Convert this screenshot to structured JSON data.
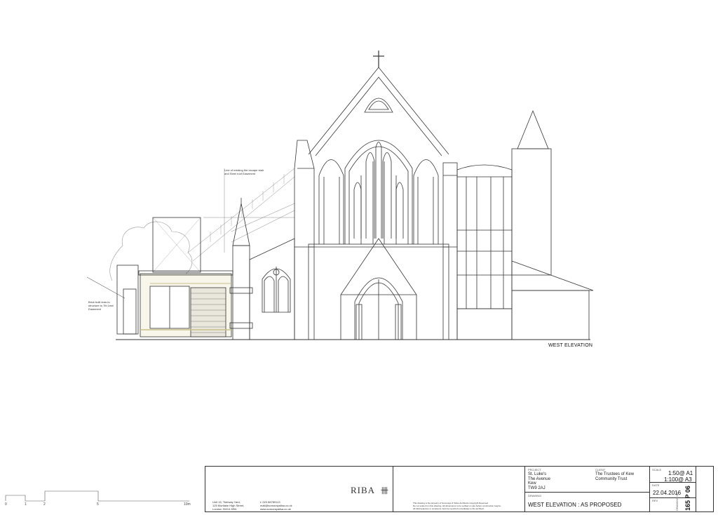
{
  "annotations": {
    "sightline_note": "Line of existing fire escape stair and Steel roof Easement",
    "left_note": "Brick built lean-to structure to 7th Leaf Easement",
    "elevation_title": "WEST ELEVATION"
  },
  "scale_bar": {
    "ticks": [
      "0",
      "1",
      "2",
      "5",
      "10m"
    ]
  },
  "title_block": {
    "office_address": [
      "Unit 15, Tideway Yard,",
      "125 Mortlake High Street,",
      "London SW14 8SN"
    ],
    "office_contact": [
      "t: 020 88789113",
      "mail@somorayallsa.co.uk",
      "www.somorayallsa.co.uk"
    ],
    "riba": "RIBA",
    "riba_mark": "卌",
    "copyright": [
      "This drawing is the property of Somorays & Tellus Architects Copyright Reserved.",
      "Do not scale from this drawing. All dimensions to be verified on site before construction begins.",
      "All discrepancies or omissions must be reported immediately to the architect."
    ],
    "project_label": "PROJECT",
    "project_lines": [
      "St. Luke's",
      "The Avenue",
      "Kew",
      "TW9 2AJ"
    ],
    "client_label": "CLIENT",
    "client_lines": [
      "The Trustees of Kew",
      "Community Trust"
    ],
    "drawing_label": "DRAWING",
    "drawing_title": "WEST ELEVATION : AS  PROPOSED",
    "scale_label": "SCALE",
    "scale_a1": "1:50@ A1",
    "scale_a3": "1:100@ A3",
    "date_label": "DATE",
    "date": "22.04.2016",
    "rev_label": "REV",
    "drawing_no_label": "DRAWING NO.",
    "drawing_no": "165 P 06"
  }
}
